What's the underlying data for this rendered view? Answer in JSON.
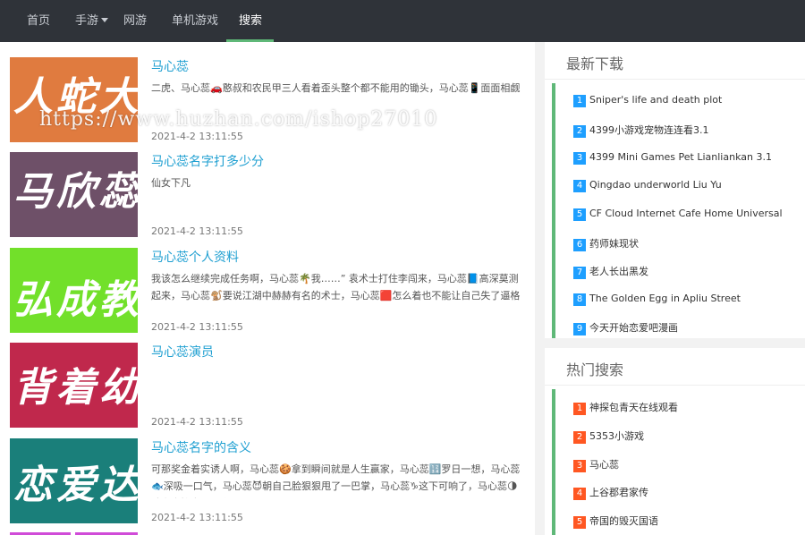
{
  "nav": {
    "items": [
      {
        "label": "首页",
        "active": false
      },
      {
        "label": "手游",
        "active": false,
        "dropdown": true
      },
      {
        "label": "网游",
        "active": false
      },
      {
        "label": "单机游戏",
        "active": false
      },
      {
        "label": "搜索",
        "active": true
      }
    ]
  },
  "watermark": "https://www.huzhan.com/ishop27010",
  "posts": [
    {
      "title": "马心蕊",
      "desc": "二虎、马心蕊🚗憨叔和农民甲三人看着歪头整个都不能用的锄头，马心蕊📱面面相觑",
      "date": "2021-4-2 13:11:55",
      "thumb_text": "人蛇大",
      "thumb_color": "#e07b3f"
    },
    {
      "title": "马心蕊名字打多少分",
      "desc": "仙女下凡",
      "date": "2021-4-2 13:11:55",
      "thumb_text": "马欣蕊",
      "thumb_color": "#6e5068"
    },
    {
      "title": "马心蕊个人资料",
      "desc": "我该怎么继续完成任务啊，马心蕊🌴我……” 袁术士打住李闯来，马心蕊📘高深莫测起来，马心蕊🐒要说江湖中赫赫有名的术士，马心蕊🟥怎么着也不能让自己失了逼格",
      "date": "2021-4-2 13:11:55",
      "thumb_text": "弘成教",
      "thumb_color": "#72e02a"
    },
    {
      "title": "马心蕊演员",
      "desc": "",
      "date": "2021-4-2 13:11:55",
      "thumb_text": "背着幼",
      "thumb_color": "#c0284c"
    },
    {
      "title": "马心蕊名字的含义",
      "desc": "可那奖金着实诱人啊，马心蕊🍪拿到瞬间就是人生赢家，马心蕊🔢罗日一想，马心蕊🐟深吸一口气，马心蕊😈朝自己脸狠狠甩了一巴掌，马心蕊♑这下可响了，马心蕊🌗脸上直接多了一个印子",
      "date": "2021-4-2 13:11:55",
      "thumb_text": "恋爱达",
      "thumb_color": "#1a7f7a"
    }
  ],
  "latest": {
    "title": "最新下载",
    "items": [
      {
        "num": "1",
        "label": "Sniper's life and death plot"
      },
      {
        "num": "2",
        "label": "4399小游戏宠物连连看3.1"
      },
      {
        "num": "3",
        "label": "4399 Mini Games Pet Lianliankan 3.1"
      },
      {
        "num": "4",
        "label": "Qingdao underworld Liu Yu"
      },
      {
        "num": "5",
        "label": "CF Cloud Internet Cafe Home Universal"
      },
      {
        "num": "6",
        "label": "药师妹现状"
      },
      {
        "num": "7",
        "label": "老人长出黑发"
      },
      {
        "num": "8",
        "label": "The Golden Egg in Apliu Street"
      },
      {
        "num": "9",
        "label": "今天开始恋爱吧漫画"
      }
    ]
  },
  "hot": {
    "title": "热门搜索",
    "items": [
      {
        "num": "1",
        "label": "神探包青天在线观看"
      },
      {
        "num": "2",
        "label": "5353小游戏"
      },
      {
        "num": "3",
        "label": "马心蕊"
      },
      {
        "num": "4",
        "label": "上谷郡君家传"
      },
      {
        "num": "5",
        "label": "帝国的毁灭国语"
      }
    ]
  },
  "colors": {
    "accent_green": "#5fb878",
    "link_blue": "#1e9fd1",
    "badge_blue": "#1e9fff",
    "badge_orange": "#ff5722",
    "nav_bg": "#2f3339"
  }
}
